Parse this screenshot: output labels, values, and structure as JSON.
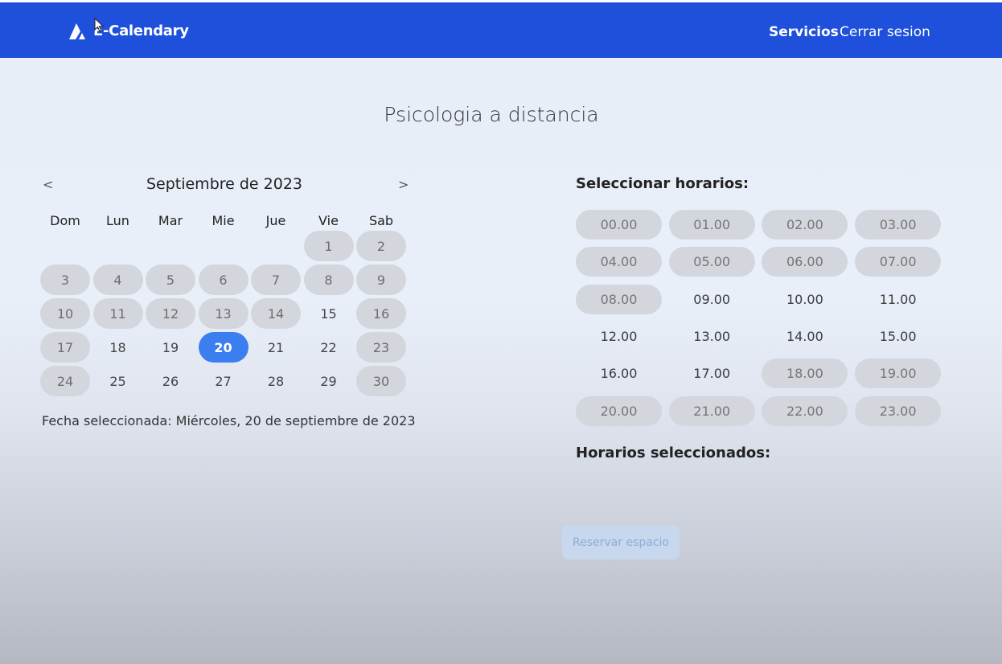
{
  "navbar": {
    "brand": "E-Calendary",
    "links": {
      "services": "Servicios",
      "logout": "Cerrar sesion"
    },
    "color": "#1e50dc"
  },
  "page": {
    "title": "Psicologia a distancia"
  },
  "calendar": {
    "prev_label": "<",
    "next_label": ">",
    "month": "Septiembre de 2023",
    "weekdays": [
      "Dom",
      "Lun",
      "Mar",
      "Mie",
      "Jue",
      "Vie",
      "Sab"
    ],
    "weeks": [
      [
        null,
        null,
        null,
        null,
        null,
        {
          "day": "1",
          "state": "disabled"
        },
        {
          "day": "2",
          "state": "disabled"
        }
      ],
      [
        {
          "day": "3",
          "state": "disabled"
        },
        {
          "day": "4",
          "state": "disabled"
        },
        {
          "day": "5",
          "state": "disabled"
        },
        {
          "day": "6",
          "state": "disabled"
        },
        {
          "day": "7",
          "state": "disabled"
        },
        {
          "day": "8",
          "state": "disabled"
        },
        {
          "day": "9",
          "state": "disabled"
        }
      ],
      [
        {
          "day": "10",
          "state": "disabled"
        },
        {
          "day": "11",
          "state": "disabled"
        },
        {
          "day": "12",
          "state": "disabled"
        },
        {
          "day": "13",
          "state": "disabled"
        },
        {
          "day": "14",
          "state": "disabled"
        },
        {
          "day": "15",
          "state": "available"
        },
        {
          "day": "16",
          "state": "disabled"
        }
      ],
      [
        {
          "day": "17",
          "state": "disabled"
        },
        {
          "day": "18",
          "state": "available"
        },
        {
          "day": "19",
          "state": "available"
        },
        {
          "day": "20",
          "state": "selected"
        },
        {
          "day": "21",
          "state": "available"
        },
        {
          "day": "22",
          "state": "available"
        },
        {
          "day": "23",
          "state": "disabled"
        }
      ],
      [
        {
          "day": "24",
          "state": "disabled"
        },
        {
          "day": "25",
          "state": "available"
        },
        {
          "day": "26",
          "state": "available"
        },
        {
          "day": "27",
          "state": "available"
        },
        {
          "day": "28",
          "state": "available"
        },
        {
          "day": "29",
          "state": "available"
        },
        {
          "day": "30",
          "state": "disabled"
        }
      ]
    ],
    "selected_color": "#3b7ef0",
    "selected_date_text": "Fecha seleccionada: Miércoles, 20 de septiembre de 2023"
  },
  "schedule": {
    "title": "Seleccionar horarios:",
    "slots": [
      {
        "time": "00.00",
        "state": "disabled"
      },
      {
        "time": "01.00",
        "state": "disabled"
      },
      {
        "time": "02.00",
        "state": "disabled"
      },
      {
        "time": "03.00",
        "state": "disabled"
      },
      {
        "time": "04.00",
        "state": "disabled"
      },
      {
        "time": "05.00",
        "state": "disabled"
      },
      {
        "time": "06.00",
        "state": "disabled"
      },
      {
        "time": "07.00",
        "state": "disabled"
      },
      {
        "time": "08.00",
        "state": "disabled"
      },
      {
        "time": "09.00",
        "state": "available"
      },
      {
        "time": "10.00",
        "state": "available"
      },
      {
        "time": "11.00",
        "state": "available"
      },
      {
        "time": "12.00",
        "state": "available"
      },
      {
        "time": "13.00",
        "state": "available"
      },
      {
        "time": "14.00",
        "state": "available"
      },
      {
        "time": "15.00",
        "state": "available"
      },
      {
        "time": "16.00",
        "state": "available"
      },
      {
        "time": "17.00",
        "state": "available"
      },
      {
        "time": "18.00",
        "state": "disabled"
      },
      {
        "time": "19.00",
        "state": "disabled"
      },
      {
        "time": "20.00",
        "state": "disabled"
      },
      {
        "time": "21.00",
        "state": "disabled"
      },
      {
        "time": "22.00",
        "state": "disabled"
      },
      {
        "time": "23.00",
        "state": "disabled"
      }
    ],
    "selected_title": "Horarios seleccionados:",
    "reserve_label": "Reservar espacio"
  }
}
